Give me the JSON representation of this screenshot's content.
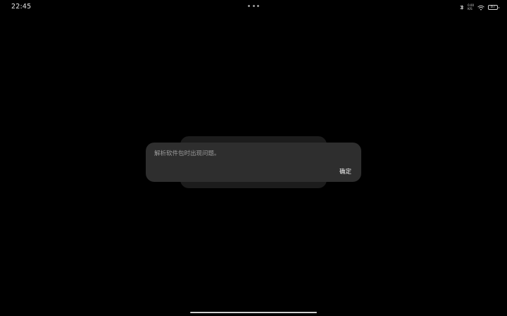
{
  "status_bar": {
    "time": "22:45",
    "icons": [
      "bluetooth-icon",
      "network-speed-indicator",
      "wifi-icon",
      "battery-icon"
    ],
    "net_speed_top": "0.00",
    "net_speed_bottom": "K/S",
    "battery_level": "87"
  },
  "top_handle": {
    "icon": "more-dots-icon"
  },
  "dialog": {
    "message": "解析软件包时出现问题。",
    "ok_label": "确定"
  },
  "colors": {
    "background": "#000000",
    "dialog_bg": "#2e2e2e",
    "message_text": "#9b9b9b",
    "button_text": "#f2f2f2"
  }
}
